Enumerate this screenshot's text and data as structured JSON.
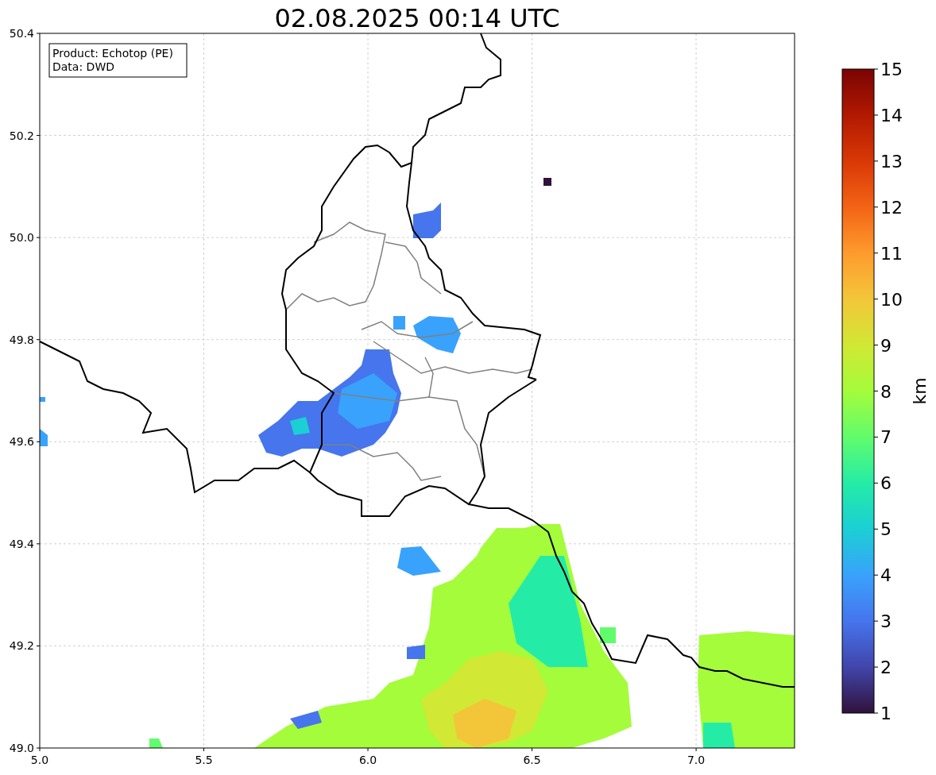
{
  "title": "02.08.2025 00:14 UTC",
  "info_box": [
    "Product: Echotop (PE)",
    "Data: DWD"
  ],
  "x_ticks": [
    "5.0",
    "5.5",
    "6.0",
    "6.5",
    "7.0"
  ],
  "y_ticks": [
    "50.4",
    "50.2",
    "50.0",
    "49.8",
    "49.6",
    "49.4",
    "49.2",
    "49.0"
  ],
  "colorbar": {
    "label": "km",
    "ticks": [
      "15",
      "14",
      "13",
      "12",
      "11",
      "10",
      "9",
      "8",
      "7",
      "6",
      "5",
      "4",
      "3",
      "2",
      "1"
    ]
  }
}
